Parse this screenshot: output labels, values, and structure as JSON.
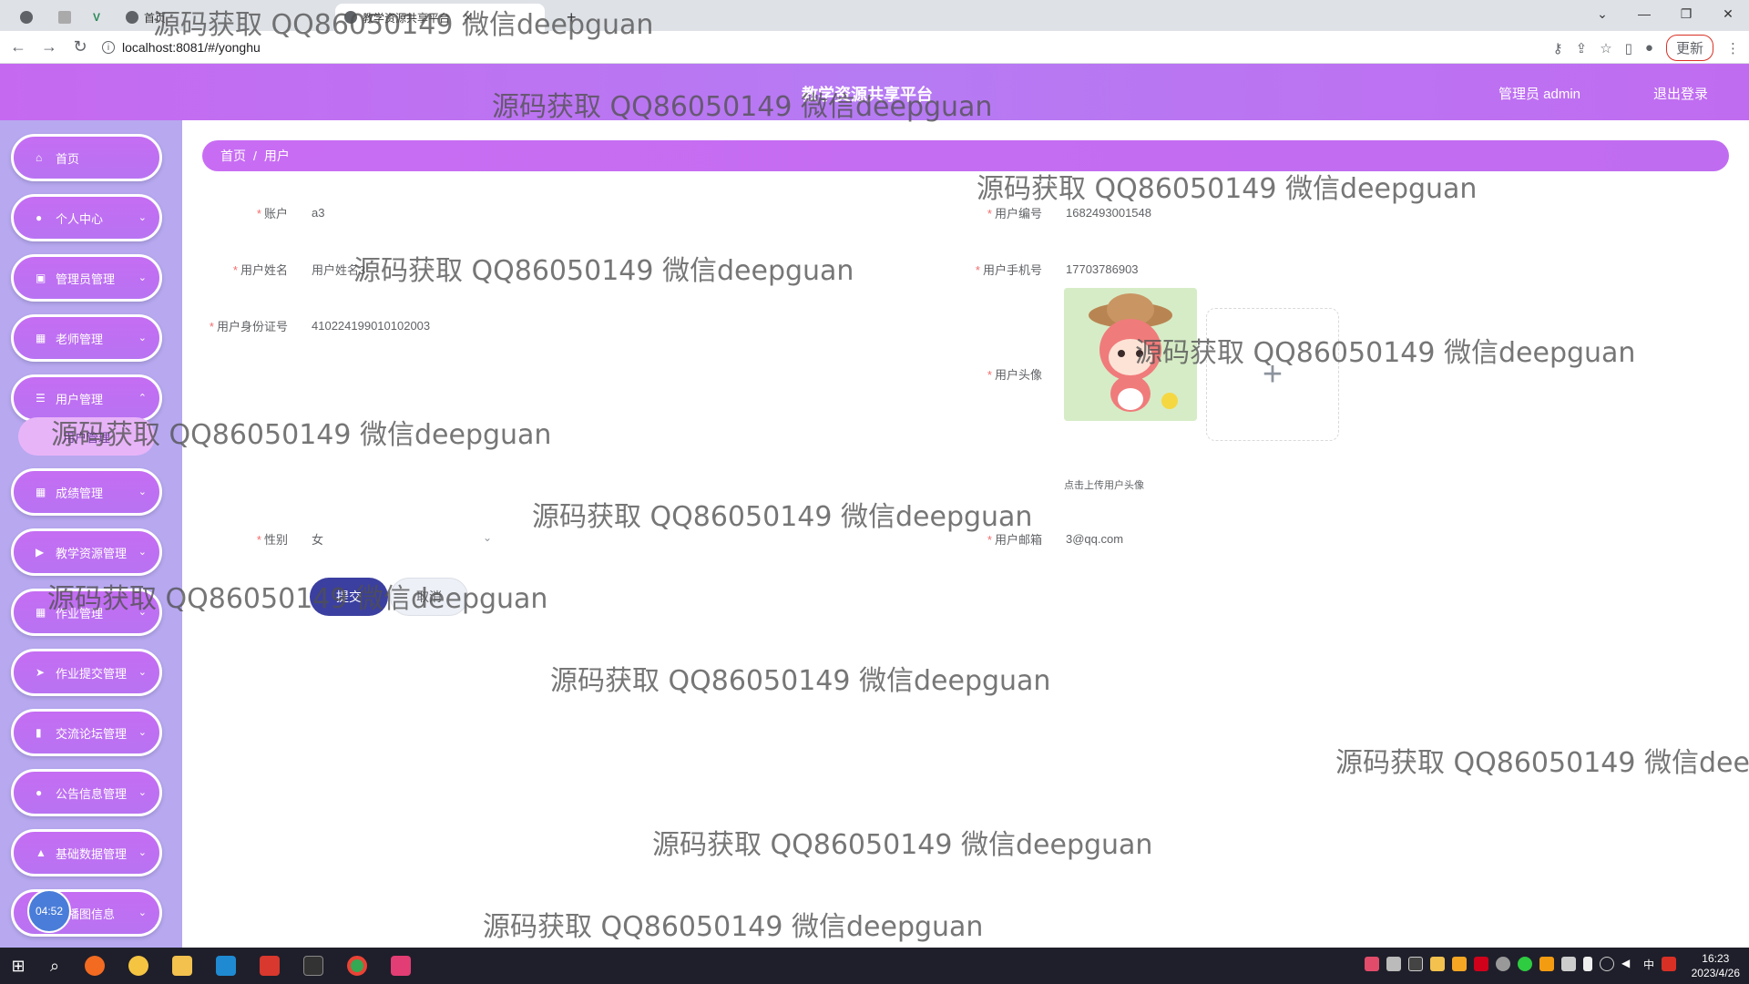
{
  "browser": {
    "tabs": [
      {
        "label": "首页"
      },
      {
        "label": "教学资源共享平台"
      }
    ],
    "url": "localhost:8081/#/yonghu",
    "update_label": "更新"
  },
  "header": {
    "title": "教学资源共享平台",
    "user": "管理员 admin",
    "logout": "退出登录"
  },
  "sidebar": {
    "items": [
      {
        "label": "首页",
        "icon": "home-icon"
      },
      {
        "label": "个人中心",
        "icon": "user-icon"
      },
      {
        "label": "管理员管理",
        "icon": "admin-icon"
      },
      {
        "label": "老师管理",
        "icon": "grid-icon"
      },
      {
        "label": "用户管理",
        "icon": "list-icon"
      },
      {
        "label": "成绩管理",
        "icon": "grid-icon"
      },
      {
        "label": "教学资源管理",
        "icon": "video-icon"
      },
      {
        "label": "作业管理",
        "icon": "grid-icon"
      },
      {
        "label": "作业提交管理",
        "icon": "send-icon"
      },
      {
        "label": "交流论坛管理",
        "icon": "chart-icon"
      },
      {
        "label": "公告信息管理",
        "icon": "bulb-icon"
      },
      {
        "label": "基础数据管理",
        "icon": "thumb-icon"
      },
      {
        "label": "轮播图信息",
        "icon": "image-icon"
      }
    ],
    "submenu_label": "用户管理",
    "timer": "04:52"
  },
  "breadcrumb": {
    "home": "首页",
    "current": "用户"
  },
  "form": {
    "account_label": "账户",
    "account": "a3",
    "user_no_label": "用户编号",
    "user_no": "1682493001548",
    "name_label": "用户姓名",
    "name": "用户姓名3",
    "phone_label": "用户手机号",
    "phone": "17703786903",
    "id_label": "用户身份证号",
    "id_card": "410224199010102003",
    "avatar_label": "用户头像",
    "avatar_tip": "点击上传用户头像",
    "gender_label": "性别",
    "gender": "女",
    "email_label": "用户邮箱",
    "email": "3@qq.com",
    "submit": "提交",
    "cancel": "取消"
  },
  "watermark": "源码获取 QQ86050149 微信deepguan",
  "taskbar": {
    "time": "16:23",
    "date": "2023/4/26",
    "ime": "中"
  }
}
